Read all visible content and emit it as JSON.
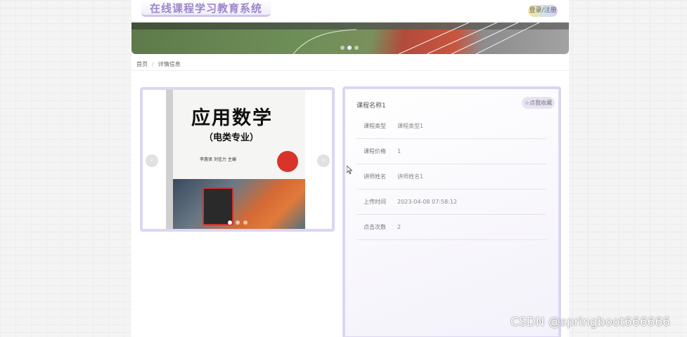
{
  "header": {
    "site_title": "在线课程学习教育系统",
    "login_label": "登录/注册"
  },
  "breadcrumb": {
    "home": "首页",
    "separator": "/",
    "current": "详情信息"
  },
  "gallery": {
    "book_title": "应用数学",
    "book_subtitle": "（电类专业）",
    "book_authors": "李惠贤   刘佳力   主编",
    "prev_icon": "‹",
    "next_icon": "›"
  },
  "detail": {
    "name": "课程名称1",
    "favorite_label": "☆点我收藏",
    "fields": [
      {
        "label": "课程类型",
        "value": "课程类型1"
      },
      {
        "label": "课程价格",
        "value": "1"
      },
      {
        "label": "讲师姓名",
        "value": "讲师姓名1"
      },
      {
        "label": "上传时间",
        "value": "2023-04-08 07:58:12"
      },
      {
        "label": "点击次数",
        "value": "2"
      }
    ]
  },
  "watermark": "CSDN @springboot666666",
  "colors": {
    "accent_border": "#dcd6f3",
    "logo_text": "#9a86c9"
  }
}
